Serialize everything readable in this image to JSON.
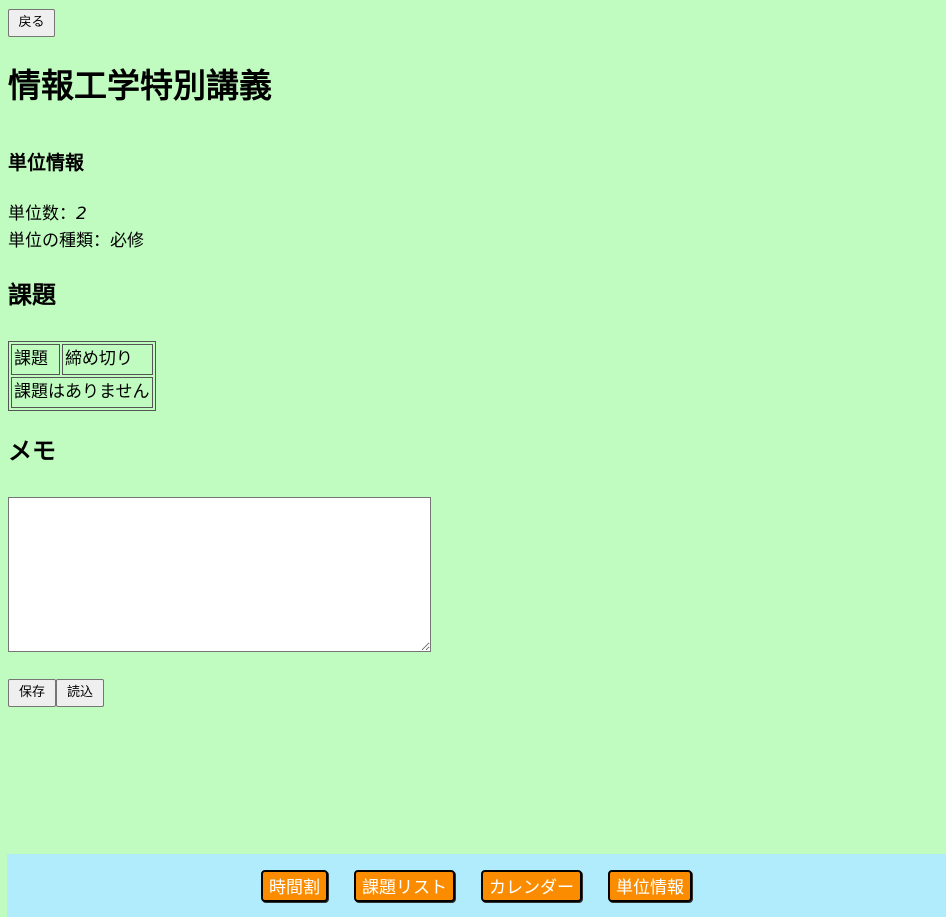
{
  "nav": {
    "back_label": "戻る"
  },
  "course": {
    "title": "情報工学特別講義"
  },
  "credit_info": {
    "heading": "単位情報",
    "count_label": "単位数：",
    "count_value": "2",
    "type_label": "単位の種類：",
    "type_value": "必修"
  },
  "tasks": {
    "heading": "課題",
    "columns": [
      "課題",
      "締め切り"
    ],
    "empty_message": "課題はありません"
  },
  "memo": {
    "heading": "メモ",
    "value": "",
    "save_label": "保存",
    "load_label": "読込"
  },
  "footer": {
    "items": [
      {
        "label": "時間割"
      },
      {
        "label": "課題リスト"
      },
      {
        "label": "カレンダー"
      },
      {
        "label": "単位情報"
      }
    ]
  },
  "colors": {
    "page_background": "#c0fcc0",
    "footer_background": "#b0ecfc",
    "nav_button": "#fb8c00"
  }
}
